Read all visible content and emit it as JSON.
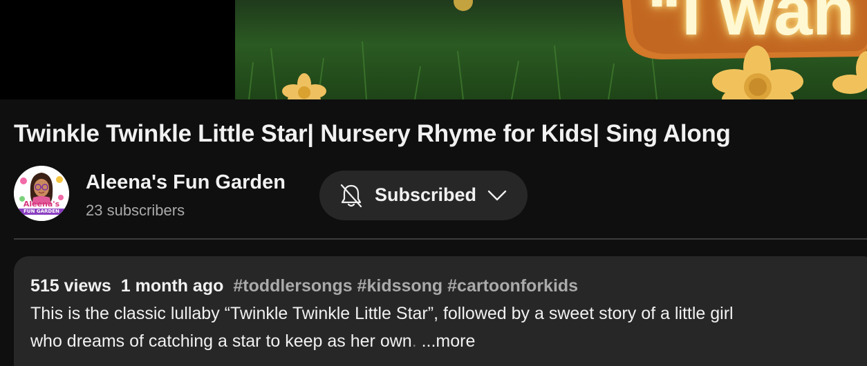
{
  "player": {
    "thumbnail_caption": "“I wan"
  },
  "video": {
    "title": "Twinkle Twinkle Little Star| Nursery Rhyme for Kids| Sing Along"
  },
  "channel": {
    "name": "Aleena's Fun Garden",
    "subscribers": "23 subscribers",
    "avatar_text_top": "Aleena's",
    "avatar_text_bottom": "FUN GARDEN"
  },
  "subscribe": {
    "label": "Subscribed",
    "icon": "bell-off-icon",
    "dropdown_icon": "chevron-down-icon"
  },
  "description": {
    "views": "515 views",
    "age": "1 month ago",
    "hashtags": "#toddlersongs #kidssong #cartoonforkids",
    "line1": "This is the classic lullaby “Twinkle Twinkle Little Star”, followed by a sweet story of a little girl",
    "line2_main": "who dreams of catching a star to keep as her own",
    "line2_faded": ".",
    "more_label": "...more"
  },
  "colors": {
    "background": "#0f0f0f",
    "surface": "#272727",
    "text_primary": "#f1f1f1",
    "text_secondary": "#aaaaaa"
  }
}
